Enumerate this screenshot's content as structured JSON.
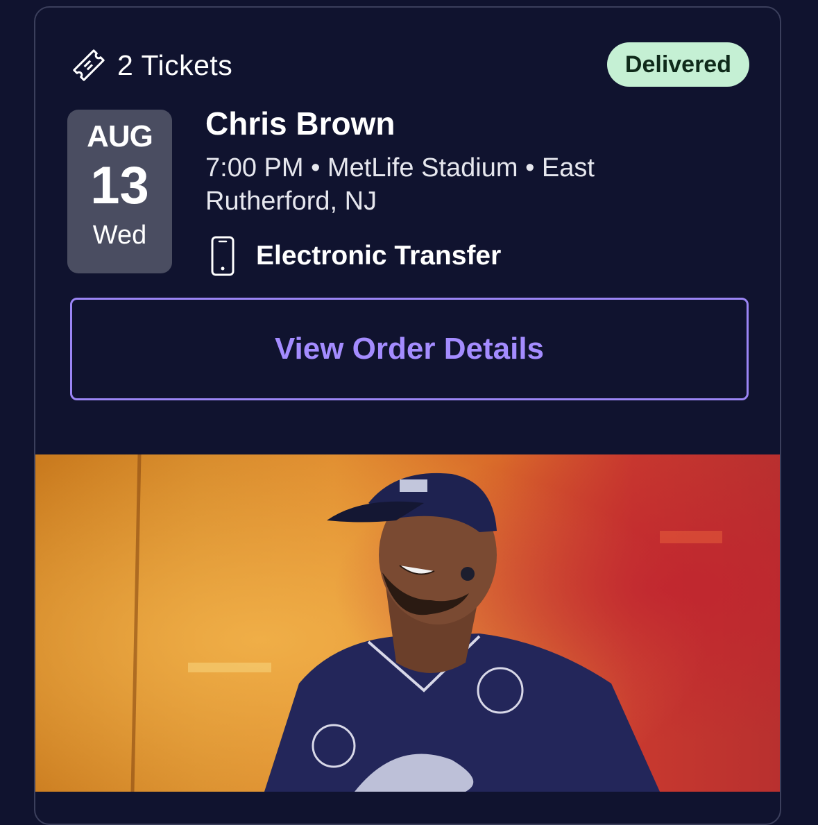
{
  "order": {
    "ticket_count_label": "2 Tickets",
    "status": "Delivered",
    "status_color": "#c5f0d4"
  },
  "event": {
    "month": "AUG",
    "day": "13",
    "weekday": "Wed",
    "title": "Chris Brown",
    "details": "7:00 PM • MetLife Stadium • East Rutherford, NJ",
    "delivery_method": "Electronic Transfer"
  },
  "actions": {
    "view_order_label": "View Order Details",
    "accent_color": "#a48cff"
  },
  "icons": {
    "ticket": "ticket-icon",
    "phone": "phone-icon"
  }
}
